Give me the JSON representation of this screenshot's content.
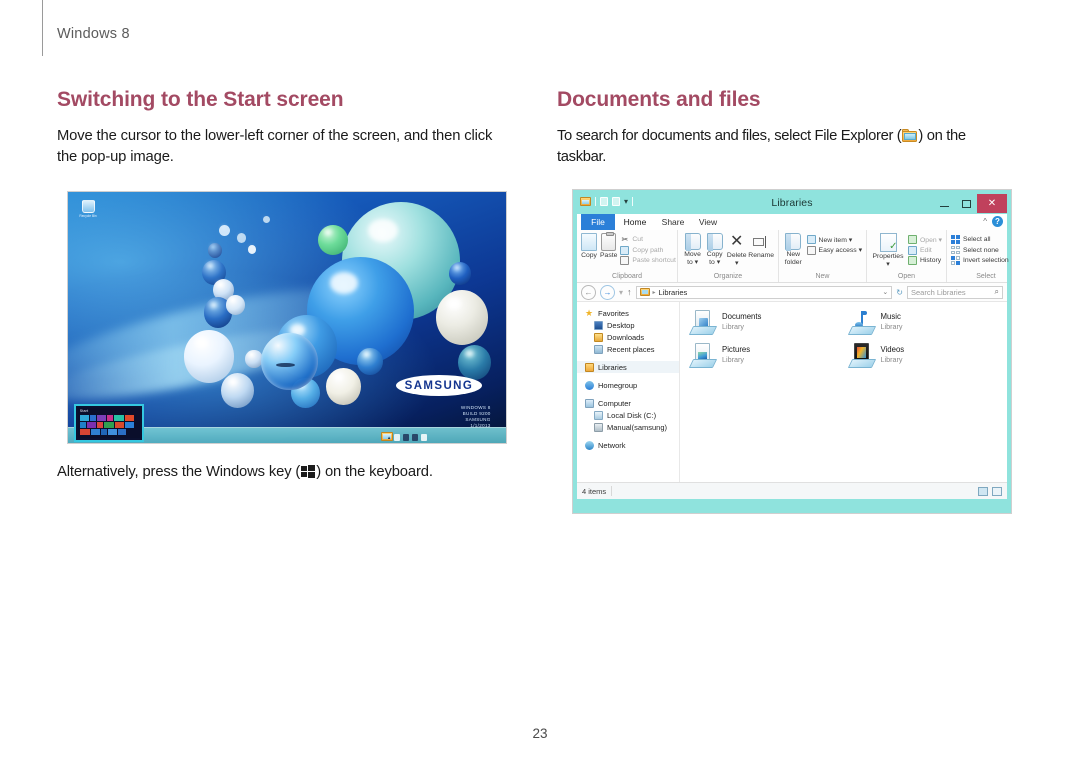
{
  "running_head": {
    "label": "Windows 8"
  },
  "page_number": "23",
  "left_column": {
    "heading": "Switching to the Start screen",
    "body": "Move the cursor to the lower-left corner of the screen, and then click the pop-up image.",
    "figure_caption_before": "Alternatively, press the Windows key (",
    "figure_caption_after": ") on the keyboard.",
    "desktop_figure": {
      "brand": "SAMSUNG",
      "watermark": "WINDOWS 8\nBUILD 9200\nSAMSUNG\n1/1/2013",
      "recycle_bin_label": "Recycle Bin",
      "start_popup_label": "Start"
    }
  },
  "right_column": {
    "heading": "Documents and files",
    "body_before": "To search for documents and files, select File Explorer (",
    "body_after": ") on the taskbar."
  },
  "explorer_window": {
    "title": "Libraries",
    "window_controls": {
      "minimize": "–",
      "maximize": "□",
      "close": "✕"
    },
    "quick_access": {
      "caret": "▾"
    },
    "tabs": [
      {
        "label": "File",
        "selected": false
      },
      {
        "label": "Home",
        "selected": true
      },
      {
        "label": "Share",
        "selected": false
      },
      {
        "label": "View",
        "selected": false
      }
    ],
    "ribbon_collapse": "^",
    "ribbon_help": "?",
    "ribbon_groups": [
      {
        "name": "Clipboard",
        "big_buttons": [
          {
            "label": "Copy"
          },
          {
            "label": "Paste"
          }
        ],
        "small_buttons": [
          {
            "label": "Cut",
            "dim": true
          },
          {
            "label": "Copy path",
            "dim": true
          },
          {
            "label": "Paste shortcut",
            "dim": true
          }
        ]
      },
      {
        "name": "Organize",
        "big_buttons": [
          {
            "label": "Move to ▾"
          },
          {
            "label": "Copy to ▾"
          },
          {
            "label": "Delete ▾"
          },
          {
            "label": "Rename"
          }
        ],
        "small_buttons": []
      },
      {
        "name": "New",
        "big_buttons": [
          {
            "label": "New folder"
          }
        ],
        "small_buttons": [
          {
            "label": "New item ▾",
            "dim": false
          },
          {
            "label": "Easy access ▾",
            "dim": false
          }
        ]
      },
      {
        "name": "Open",
        "big_buttons": [
          {
            "label": "Properties ▾"
          }
        ],
        "small_buttons": [
          {
            "label": "Open ▾",
            "dim": true
          },
          {
            "label": "Edit",
            "dim": true
          },
          {
            "label": "History",
            "dim": false
          }
        ]
      },
      {
        "name": "Select",
        "big_buttons": [],
        "small_buttons": [
          {
            "label": "Select all",
            "dim": false
          },
          {
            "label": "Select none",
            "dim": false
          },
          {
            "label": "Invert selection",
            "dim": false
          }
        ]
      }
    ],
    "address_bar": {
      "back": "←",
      "forward": "→",
      "recent": "▾",
      "up": "↑",
      "path": "Libraries",
      "path_separator": "▸",
      "history_chevron": "⌄",
      "refresh": "↻",
      "search_placeholder": "Search Libraries",
      "search_icon": "⌕"
    },
    "nav_pane": [
      {
        "label": "Favorites",
        "level": 0,
        "icon": "star-icon",
        "selected": false
      },
      {
        "label": "Desktop",
        "level": 1,
        "icon": "desktop-icon",
        "selected": false
      },
      {
        "label": "Downloads",
        "level": 1,
        "icon": "downloads-icon",
        "selected": false
      },
      {
        "label": "Recent places",
        "level": 1,
        "icon": "recent-places-icon",
        "selected": false
      },
      {
        "label": "Libraries",
        "level": 0,
        "icon": "libraries-icon",
        "selected": true
      },
      {
        "label": "Homegroup",
        "level": 0,
        "icon": "homegroup-icon",
        "selected": false
      },
      {
        "label": "Computer",
        "level": 0,
        "icon": "computer-icon",
        "selected": false
      },
      {
        "label": "Local Disk (C:)",
        "level": 1,
        "icon": "disk-icon",
        "selected": false
      },
      {
        "label": "Manual(samsung)",
        "level": 1,
        "icon": "drive-icon",
        "selected": false
      },
      {
        "label": "Network",
        "level": 0,
        "icon": "network-icon",
        "selected": false
      }
    ],
    "libraries": [
      {
        "name": "Documents",
        "type": "Library",
        "icon": "documents-library-icon"
      },
      {
        "name": "Music",
        "type": "Library",
        "icon": "music-library-icon"
      },
      {
        "name": "Pictures",
        "type": "Library",
        "icon": "pictures-library-icon"
      },
      {
        "name": "Videos",
        "type": "Library",
        "icon": "videos-library-icon"
      }
    ],
    "status_bar": {
      "item_count": "4 items",
      "view_details": "details-view-icon",
      "view_large": "large-icons-view-icon"
    }
  },
  "colors": {
    "heading": "#a34a63",
    "body_text": "#1b1b1b",
    "running_head": "#5c5c5c",
    "explorer_chrome": "#8fe3dd",
    "tab_active": "#2b7fd8",
    "close_button": "#c0415c",
    "popup_border": "#35c8e0"
  }
}
